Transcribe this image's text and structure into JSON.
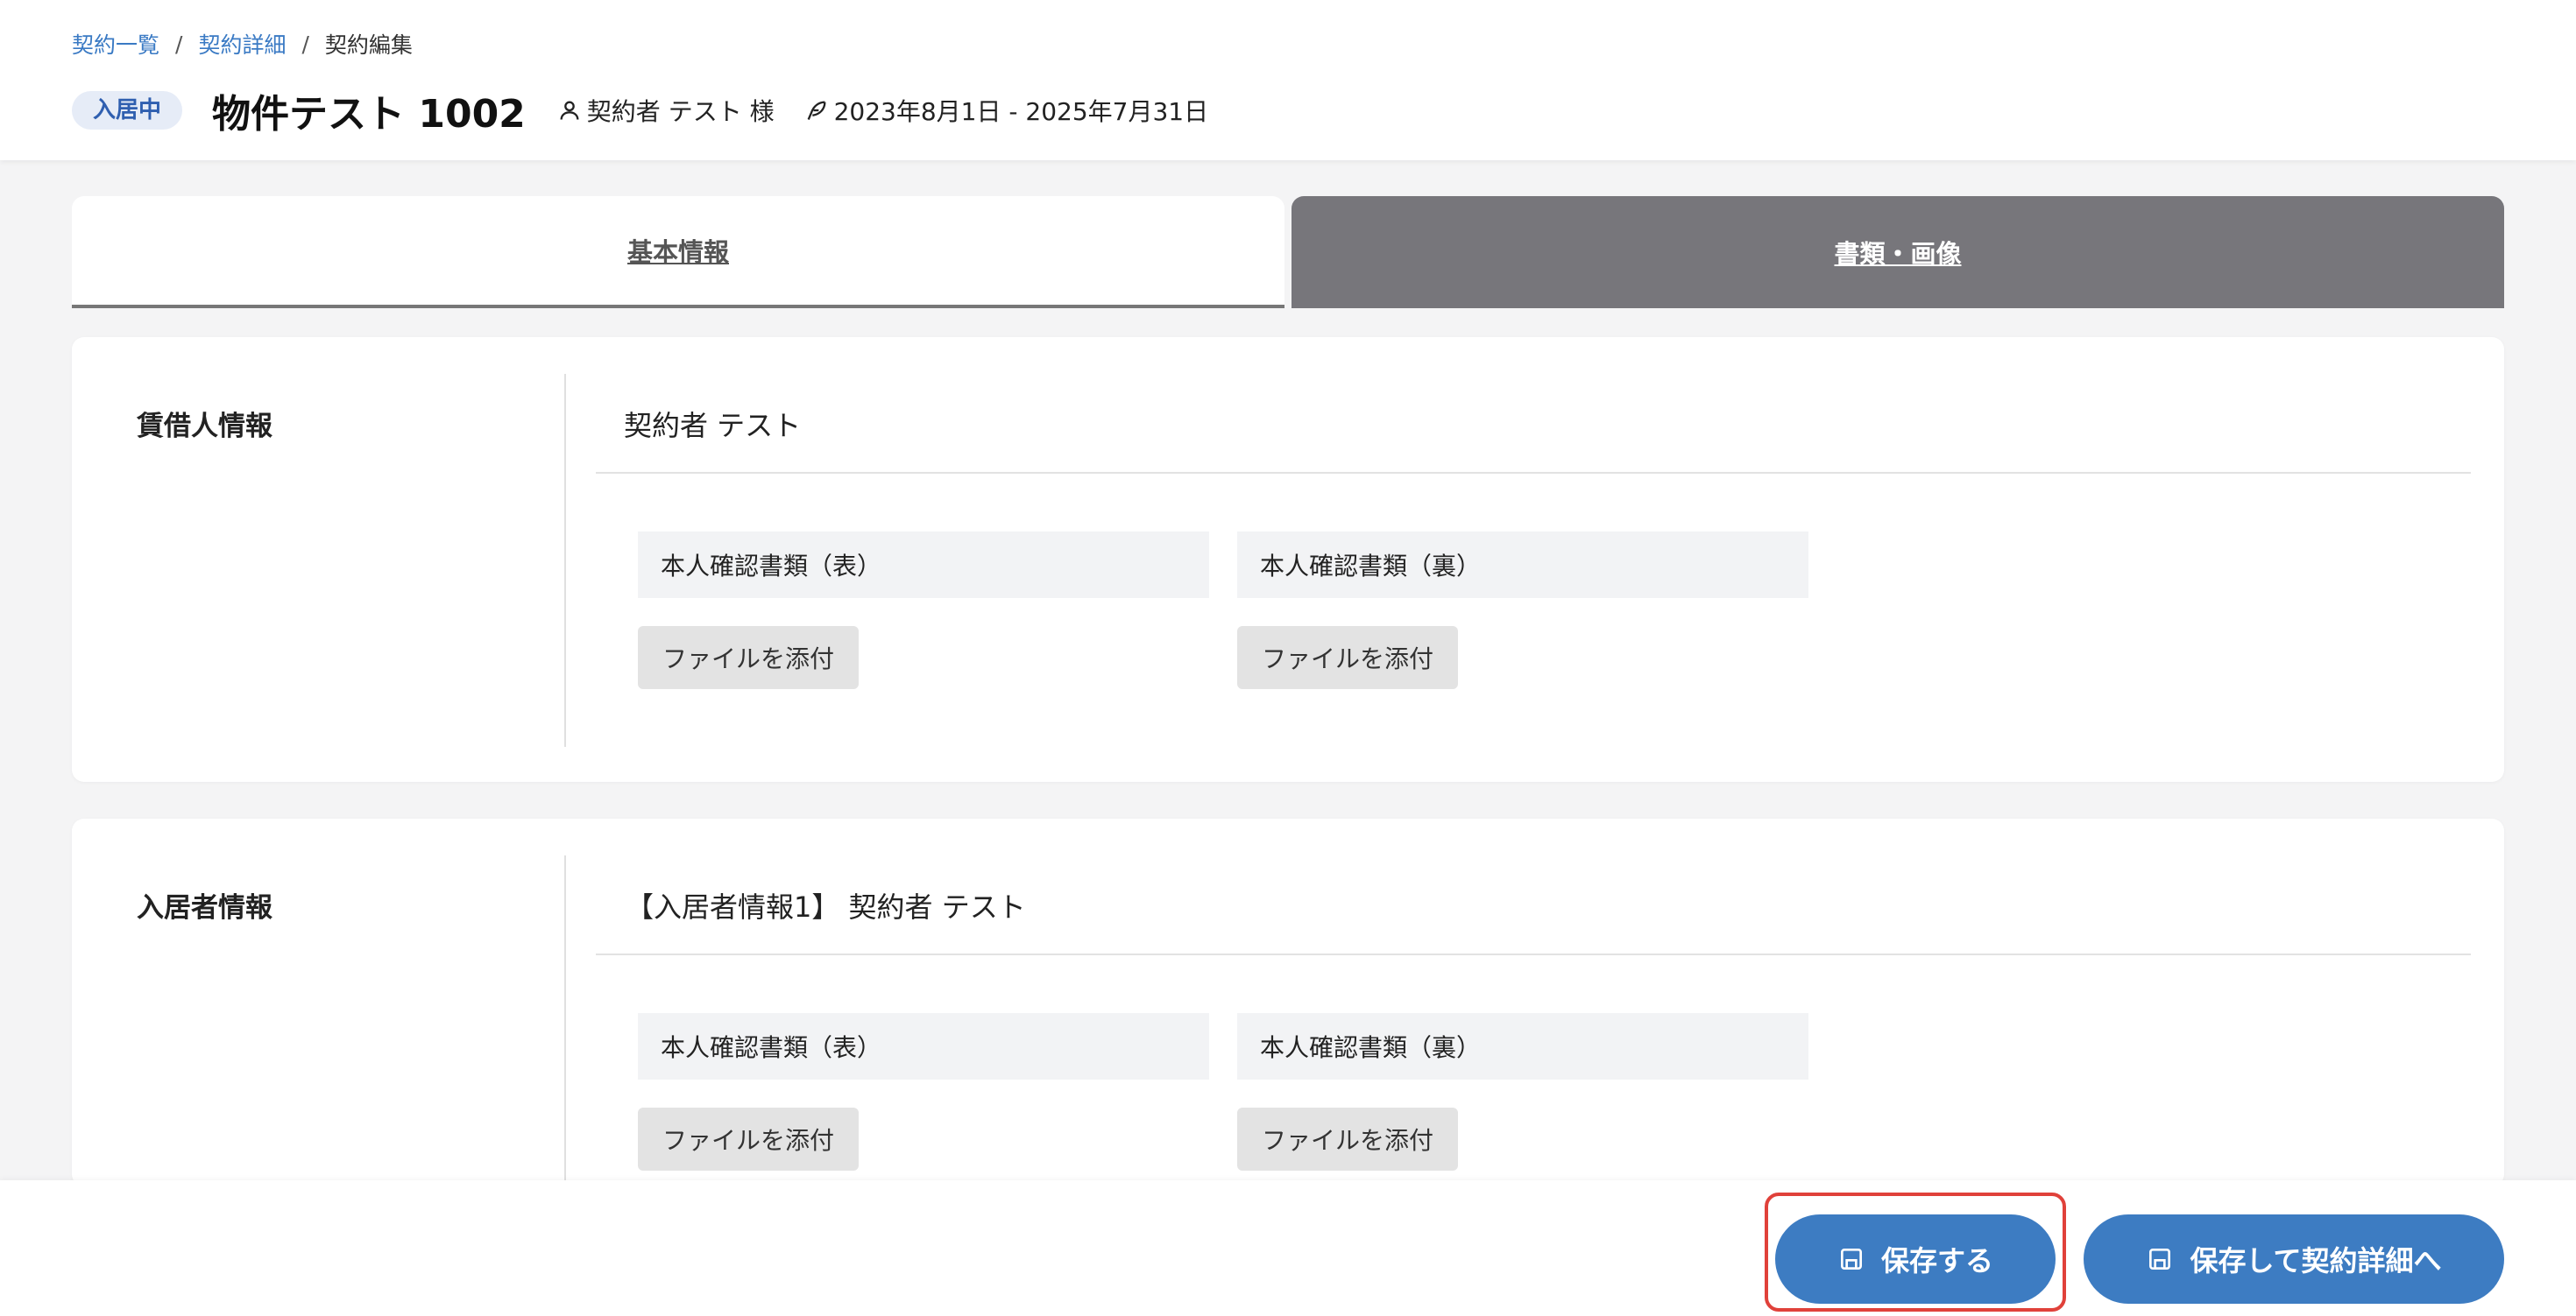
{
  "breadcrumb": {
    "items": [
      {
        "label": "契約一覧"
      },
      {
        "label": "契約詳細"
      }
    ],
    "separator": "/",
    "current": "契約編集"
  },
  "header": {
    "status_badge": "入居中",
    "property_title": "物件テスト 1002",
    "contractor": "契約者 テスト 様",
    "period": "2023年8月1日 - 2025年7月31日"
  },
  "tabs": [
    {
      "label": "基本情報",
      "active": false
    },
    {
      "label": "書類・画像",
      "active": true
    }
  ],
  "sections": [
    {
      "label": "賃借人情報",
      "name": "契約者 テスト",
      "documents": [
        {
          "label": "本人確認書類（表）",
          "button": "ファイルを添付"
        },
        {
          "label": "本人確認書類（裏）",
          "button": "ファイルを添付"
        }
      ]
    },
    {
      "label": "入居者情報",
      "name": "【入居者情報1】 契約者 テスト",
      "documents": [
        {
          "label": "本人確認書類（表）",
          "button": "ファイルを添付"
        },
        {
          "label": "本人確認書類（裏）",
          "button": "ファイルを添付"
        }
      ]
    }
  ],
  "footer": {
    "save_label": "保存する",
    "save_and_detail_label": "保存して契約詳細へ"
  },
  "colors": {
    "primary": "#3d7cc2",
    "active_tab": "#77767b",
    "highlight": "#e0413a",
    "badge_bg": "#e6ecf7"
  },
  "icons": [
    "user-icon",
    "feather-pen-icon",
    "save-icon"
  ]
}
